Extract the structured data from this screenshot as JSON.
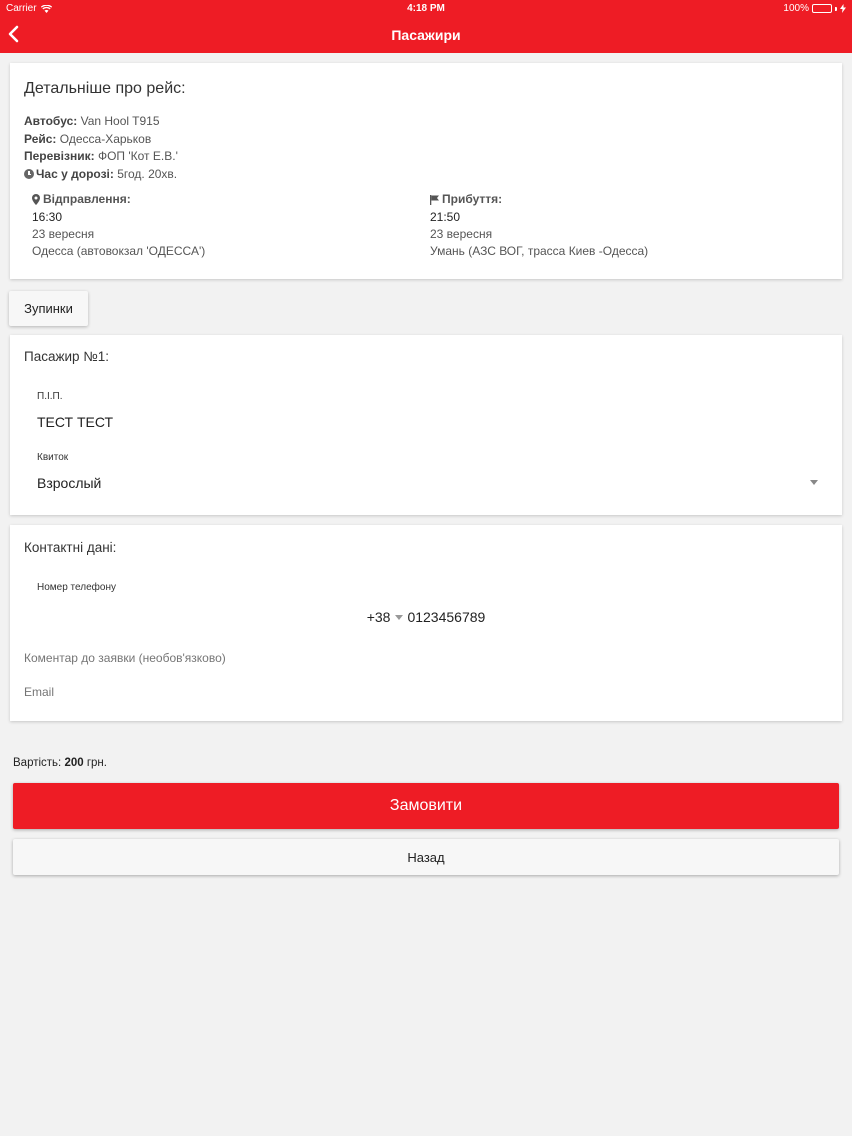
{
  "status_bar": {
    "carrier": "Carrier",
    "time": "4:18 PM",
    "battery": "100%",
    "battery_level": 1.0
  },
  "header": {
    "title": "Пасажири",
    "accent_color": "#ee1c25"
  },
  "trip": {
    "title": "Детальніше про рейс:",
    "bus_label": "Автобус:",
    "bus_value": "Van Hool T915",
    "route_label": "Рейс:",
    "route_value": "Одесса-Харьков",
    "carrier_label": "Перевізник:",
    "carrier_value": "ФОП 'Кот Е.В.'",
    "duration_label": "Час у дорозі:",
    "duration_value": "5год. 20хв.",
    "departure": {
      "label": "Відправлення:",
      "time": "16:30",
      "date": "23 вересня",
      "place": "Одесса (автовокзал 'ОДЕССА')"
    },
    "arrival": {
      "label": "Прибуття:",
      "time": "21:50",
      "date": "23 вересня",
      "place": "Умань (АЗС ВОГ, трасса Киев -Одесса)"
    }
  },
  "stops_button": "Зупинки",
  "passenger": {
    "title": "Пасажир №1:",
    "name_label": "П.І.П.",
    "name_value": "ТЕСТ ТЕСТ",
    "ticket_label": "Квиток",
    "ticket_value": "Взрослый"
  },
  "contacts": {
    "title": "Контактні дані:",
    "phone_label": "Номер телефону",
    "phone_code": "+38",
    "phone_number": "0123456789",
    "comment_placeholder": "Коментар до заявки (необов'язково)",
    "email_placeholder": "Email"
  },
  "price": {
    "label": "Вартість:",
    "amount": "200",
    "currency": "грн."
  },
  "order_button": "Замовити",
  "back_button": "Назад"
}
